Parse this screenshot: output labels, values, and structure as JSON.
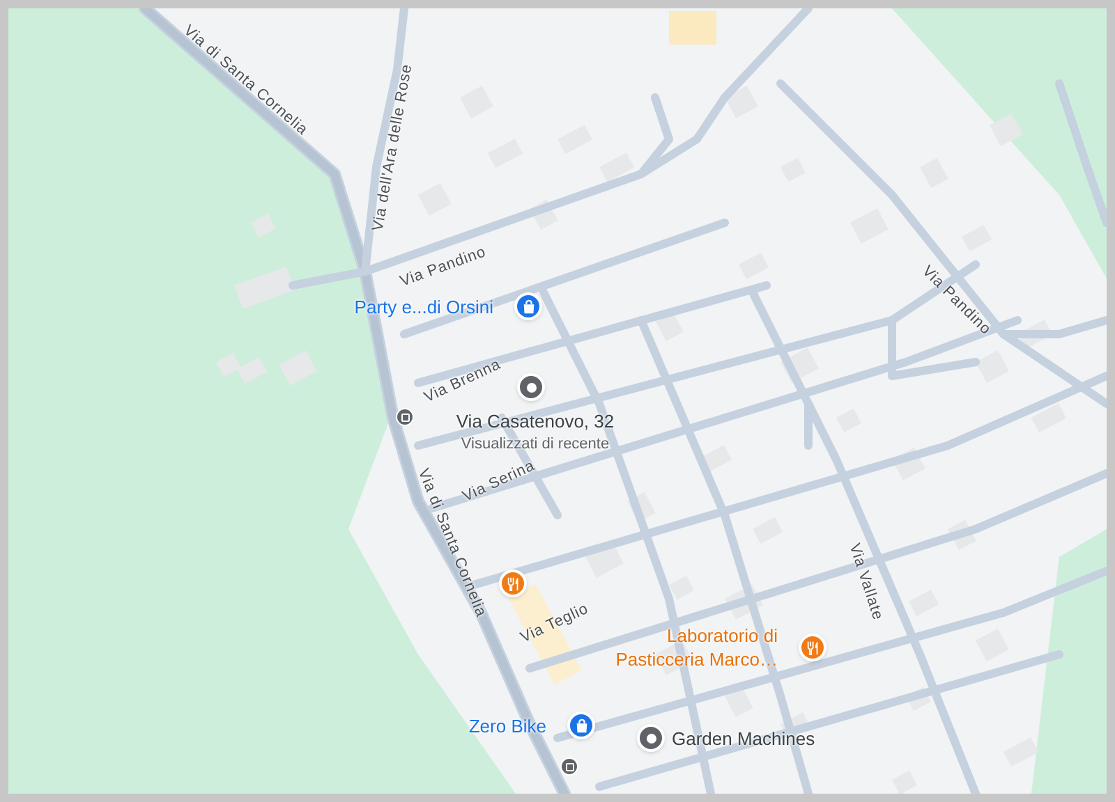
{
  "streets": [
    {
      "name": "Via di Santa Cornelia"
    },
    {
      "name": "Via dell'Ara delle Rose"
    },
    {
      "name": "Via Pandino"
    },
    {
      "name": "Via Pandino"
    },
    {
      "name": "Via Brenna"
    },
    {
      "name": "Via Serina"
    },
    {
      "name": "Via di Santa Cornelia"
    },
    {
      "name": "Via Teglio"
    },
    {
      "name": "Via Vallate"
    }
  ],
  "places": [
    {
      "kind": "shop",
      "lines": [
        "Party e...di Orsini"
      ]
    },
    {
      "kind": "location",
      "lines": [
        "Via Casatenovo, 32",
        "Visualizzati di recente"
      ]
    },
    {
      "kind": "restaurant"
    },
    {
      "kind": "restaurant",
      "lines": [
        "Laboratorio di",
        "Pasticceria Marco…"
      ]
    },
    {
      "kind": "shop",
      "lines": [
        "Zero Bike"
      ]
    },
    {
      "kind": "location",
      "lines": [
        "Garden Machines"
      ]
    }
  ],
  "bus_stops": [
    {
      "kind": "bus"
    },
    {
      "kind": "bus"
    }
  ]
}
